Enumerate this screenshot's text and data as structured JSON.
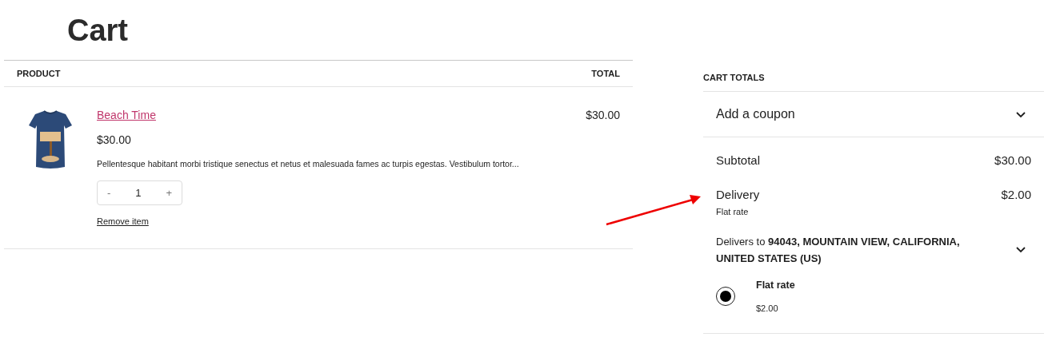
{
  "page_title": "Cart",
  "table": {
    "columns": [
      "PRODUCT",
      "TOTAL"
    ],
    "items": [
      {
        "kind": "picture",
        "name": "Beach Time",
        "price": "$30.00",
        "description": "Pellentesque habitant morbi tristique senectus et netus et malesuada fames ac turpis egestas. Vestibulum tortor...",
        "quantity": {
          "decrease": "-",
          "value": "1",
          "increase": "+"
        },
        "remove": "Remove item",
        "total": "$30.00"
      }
    ]
  },
  "cart_totals": {
    "title": "CART TOTALS",
    "coupon": {
      "label": "Add a coupon",
      "expanded": false
    },
    "subtotal": {
      "label": "Subtotal",
      "value": "$30.00"
    },
    "delivery": {
      "label": "Delivery",
      "value": "$2.00",
      "method": "Flat rate"
    },
    "delivers_to": {
      "text": "Delivers to **94043, MOUNTAIN VIEW, CALIFORNIA, UNITED STATES (US)**",
      "expanded": false
    },
    "shipping_options": [
      {
        "label": "Flat rate",
        "price": "$2.00",
        "selected": true
      }
    ]
  },
  "annotation": {
    "kind": "arrow"
  }
}
